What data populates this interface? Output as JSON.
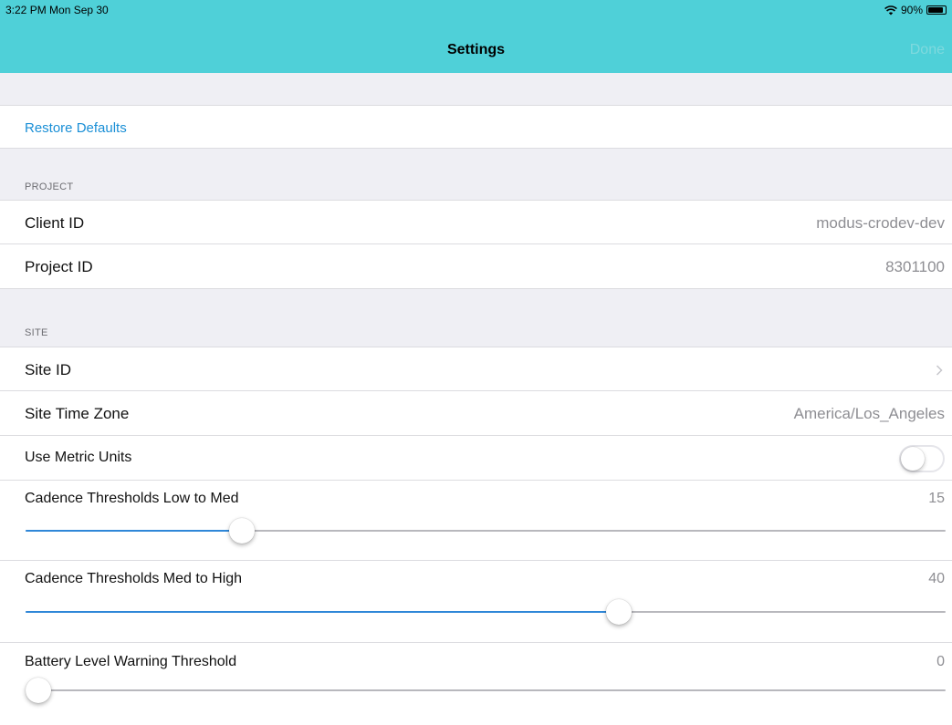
{
  "status_bar": {
    "time": "3:22 PM  Mon Sep 30",
    "battery": "90%",
    "battery_level": 0.9
  },
  "nav": {
    "title": "Settings",
    "done_label": "Done"
  },
  "restore_defaults": "Restore Defaults",
  "project": {
    "header": "PROJECT",
    "client_id_label": "Client ID",
    "client_id_value": "modus-crodev-dev",
    "project_id_label": "Project ID",
    "project_id_value": "8301100"
  },
  "site": {
    "header": "SITE",
    "site_id_label": "Site ID",
    "time_zone_label": "Site Time Zone",
    "time_zone_value": "America/Los_Angeles",
    "metric_label": "Use Metric Units",
    "metric_on": false,
    "cadence_low_label": "Cadence Thresholds Low to Med",
    "cadence_low_value": "15",
    "cadence_low_fraction": 0.235,
    "cadence_high_label": "Cadence Thresholds Med to High",
    "cadence_high_value": "40",
    "cadence_high_fraction": 0.645,
    "battery_label": "Battery Level Warning Threshold",
    "battery_value": "0",
    "battery_fraction": 0.0
  }
}
